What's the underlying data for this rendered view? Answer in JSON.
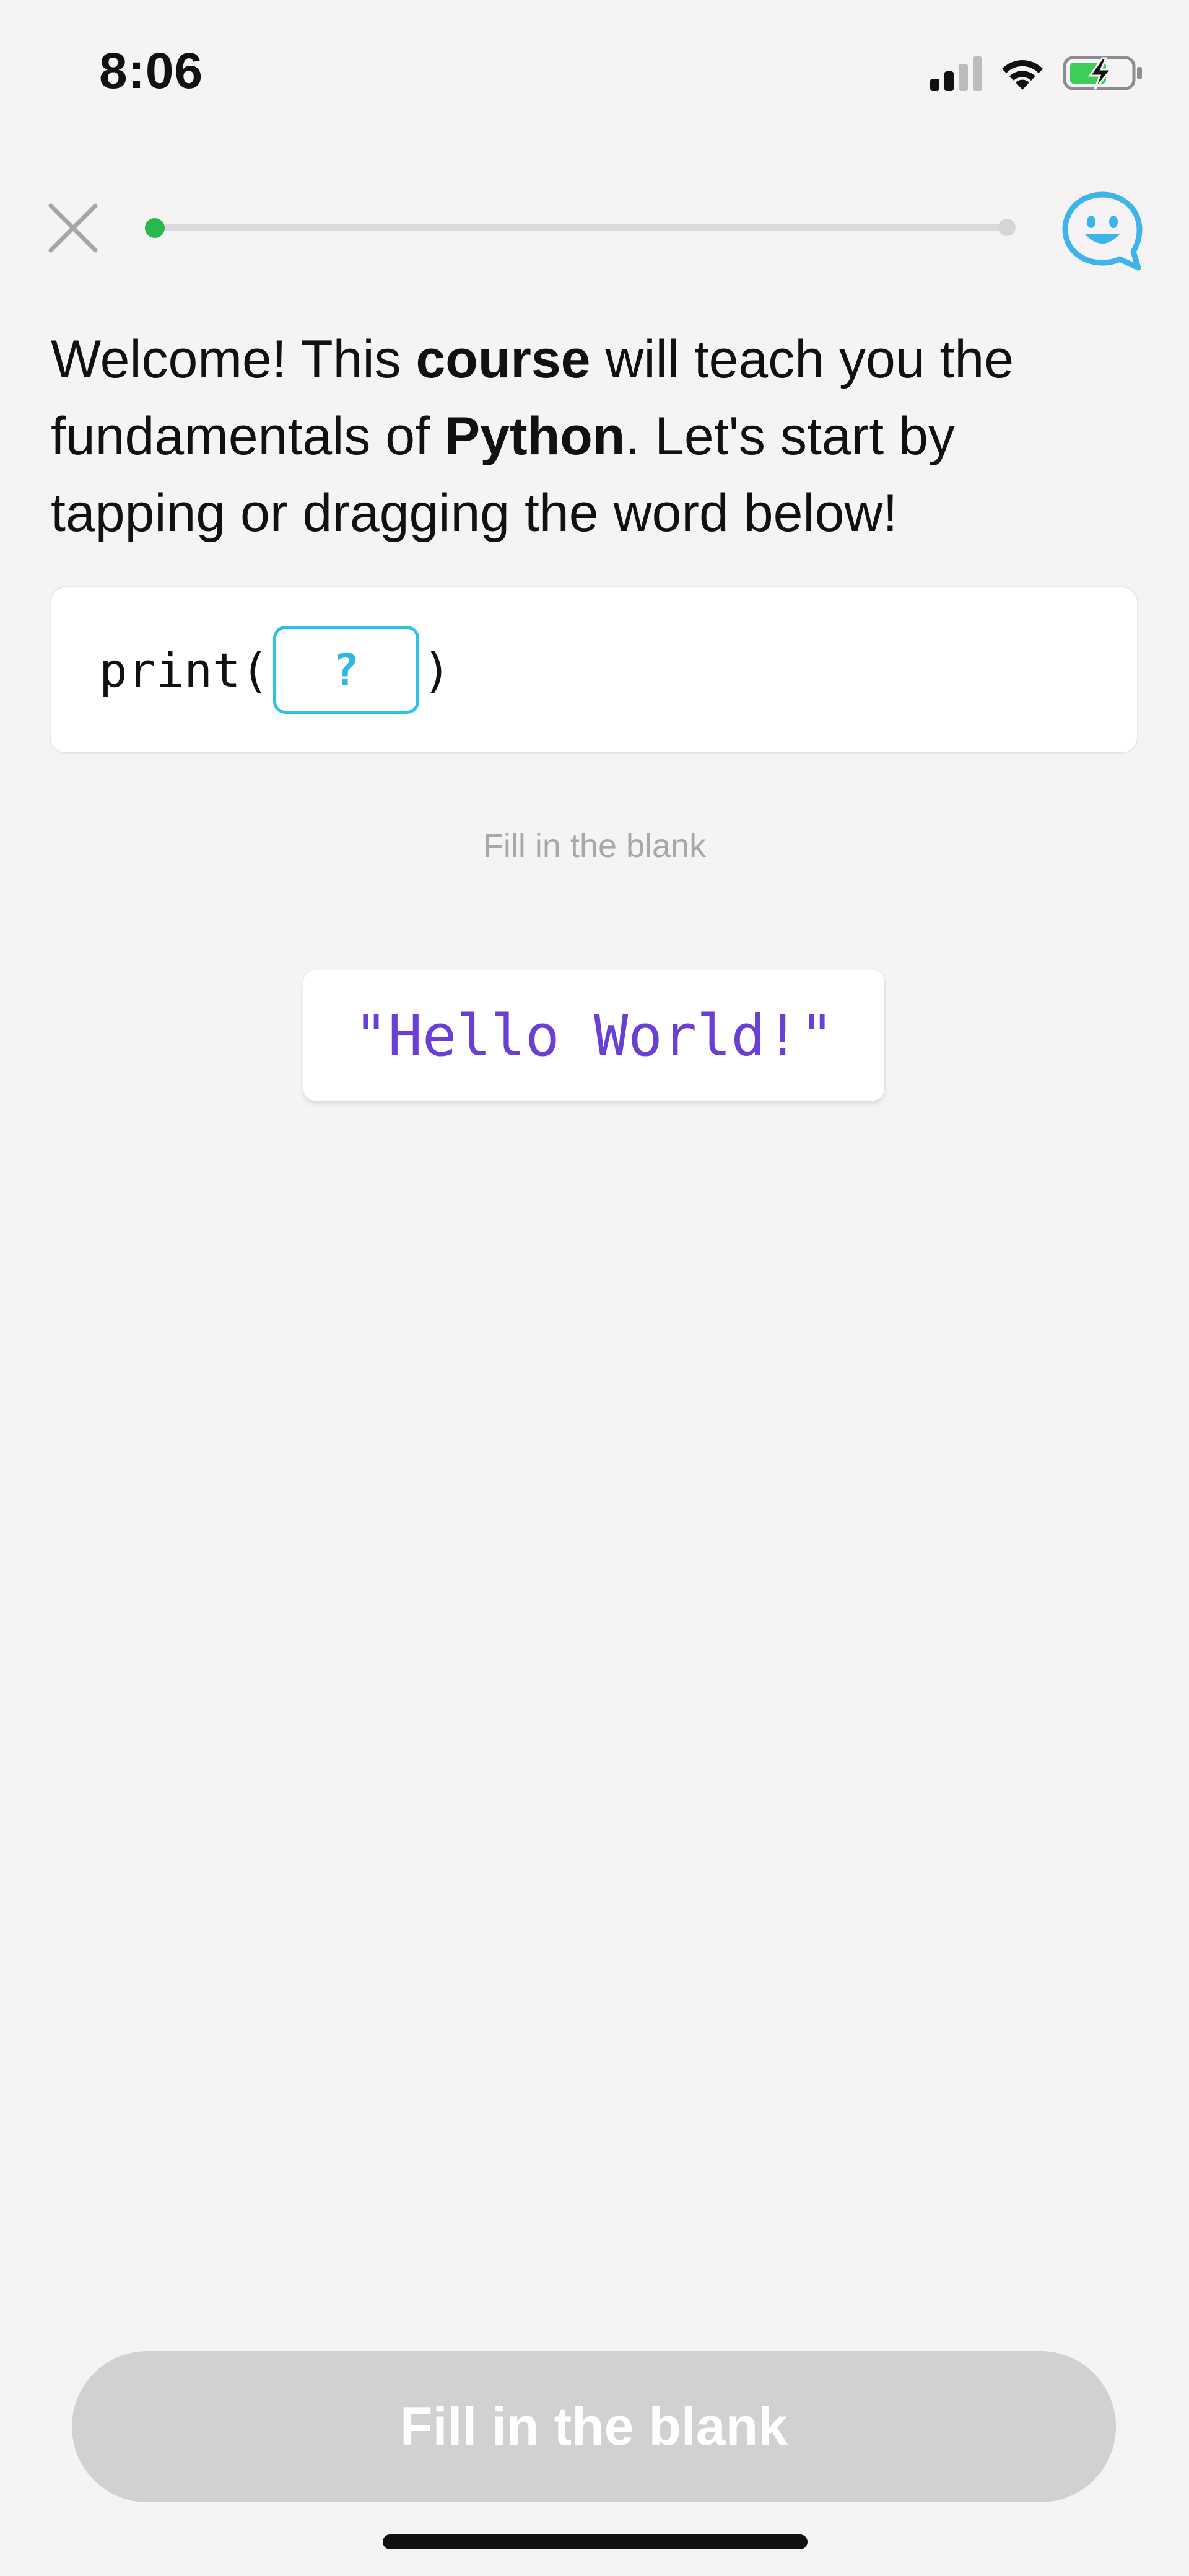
{
  "status_bar": {
    "time": "8:06",
    "icons": [
      "cellular-signal-icon",
      "wifi-icon",
      "battery-charging-icon"
    ]
  },
  "top_bar": {
    "close_icon": "close-icon",
    "progress": 0.0,
    "support_icon": "chat-smiley-icon",
    "accent_color": "#29b94b",
    "support_color": "#3fb4ea"
  },
  "lesson": {
    "instruction_parts": {
      "p1": "Welcome!  This ",
      "b1": "course",
      "p2": " will teach you the fundamentals of ",
      "b2": "Python",
      "p3": ". Let's start by tapping or dragging the word below!"
    },
    "code": {
      "prefix": "print(",
      "blank": "?",
      "suffix": ")"
    },
    "hint": "Fill in the blank",
    "options": [
      "\"Hello World!\""
    ]
  },
  "footer": {
    "button_label": "Fill in the blank"
  },
  "colors": {
    "background": "#f5f3f4",
    "blank_border": "#2fc2e6",
    "option_text": "#6a3fd6",
    "button_disabled": "#d2d1d2"
  }
}
